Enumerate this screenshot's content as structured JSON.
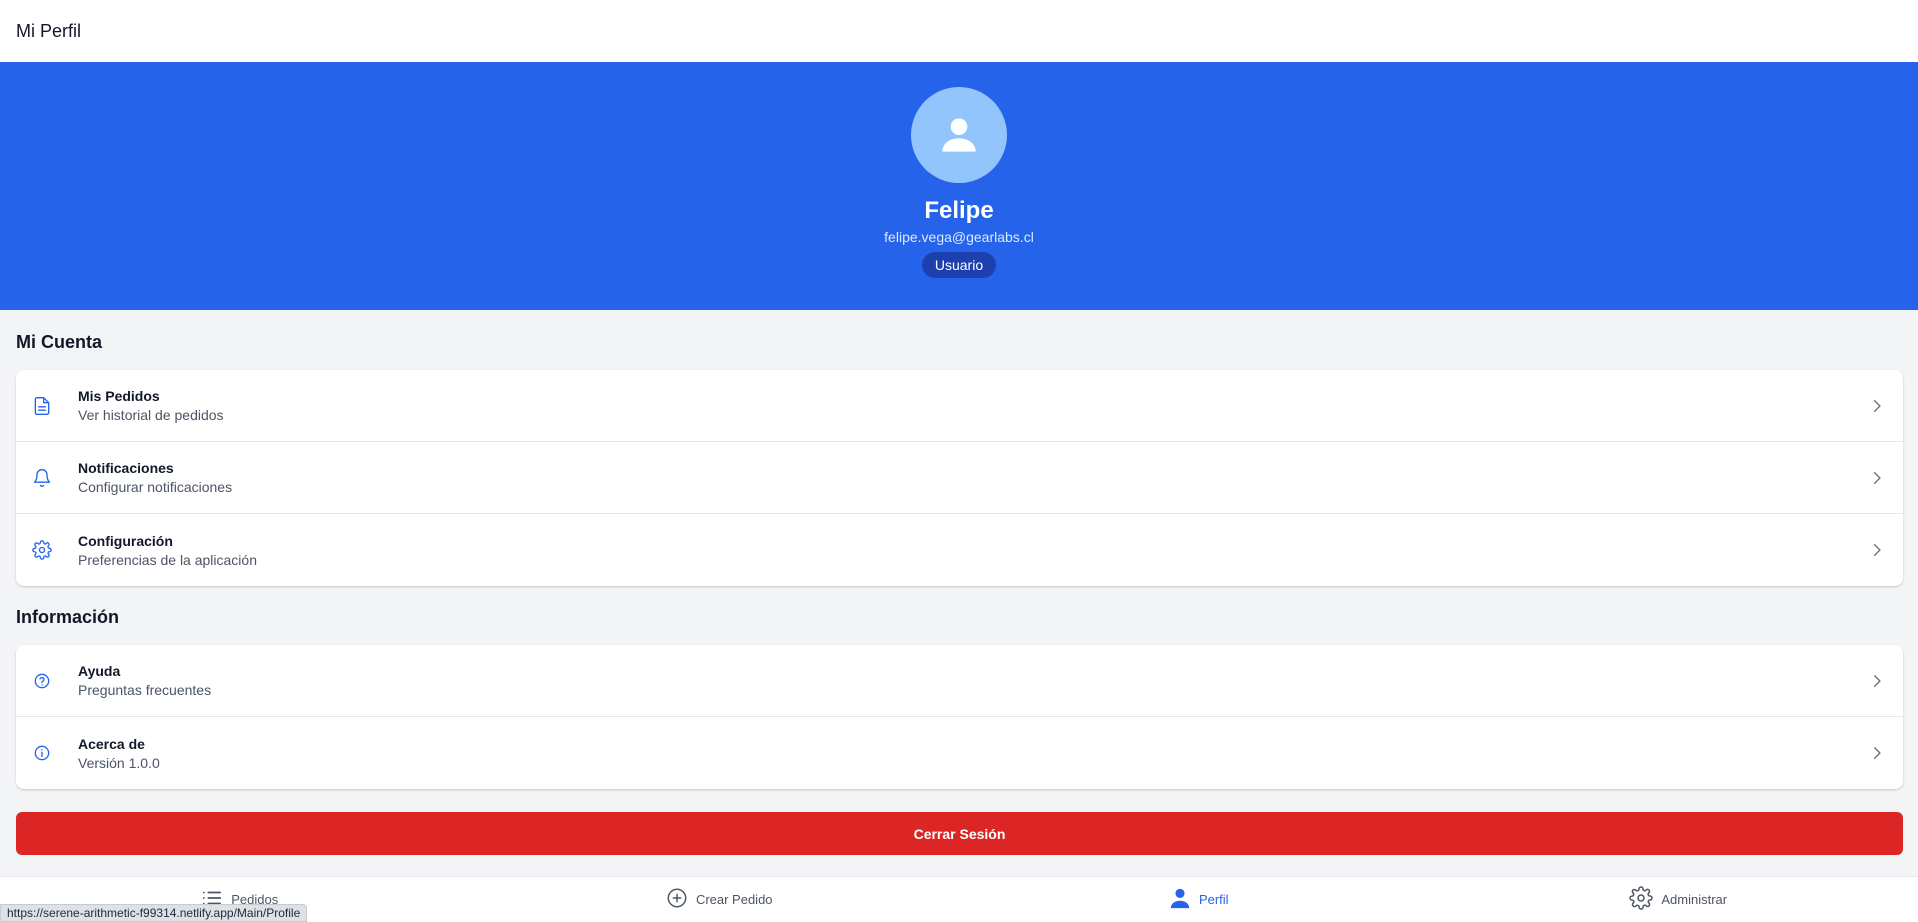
{
  "header": {
    "title": "Mi Perfil"
  },
  "profile": {
    "name": "Felipe",
    "email": "felipe.vega@gearlabs.cl",
    "role": "Usuario"
  },
  "account_section": {
    "title": "Mi Cuenta",
    "items": [
      {
        "label": "Mis Pedidos",
        "sub": "Ver historial de pedidos",
        "icon": "document-icon"
      },
      {
        "label": "Notificaciones",
        "sub": "Configurar notificaciones",
        "icon": "bell-icon"
      },
      {
        "label": "Configuración",
        "sub": "Preferencias de la aplicación",
        "icon": "gear-icon"
      }
    ]
  },
  "info_section": {
    "title": "Información",
    "items": [
      {
        "label": "Ayuda",
        "sub": "Preguntas frecuentes",
        "icon": "help-circle-icon"
      },
      {
        "label": "Acerca de",
        "sub": "Versión 1.0.0",
        "icon": "info-circle-icon"
      }
    ]
  },
  "logout_label": "Cerrar Sesión",
  "nav": {
    "items": [
      {
        "label": "Pedidos",
        "icon": "list-icon"
      },
      {
        "label": "Crear Pedido",
        "icon": "plus-circle-icon"
      },
      {
        "label": "Perfil",
        "icon": "user-icon",
        "active": true
      },
      {
        "label": "Administrar",
        "icon": "gear-icon"
      }
    ]
  },
  "status_url": "https://serene-arithmetic-f99314.netlify.app/Main/Profile",
  "colors": {
    "primary": "#2563eb",
    "avatar_bg": "#93c5fd",
    "badge_bg": "#1e40af",
    "danger": "#dc2626",
    "page_bg": "#f3f4f6"
  }
}
